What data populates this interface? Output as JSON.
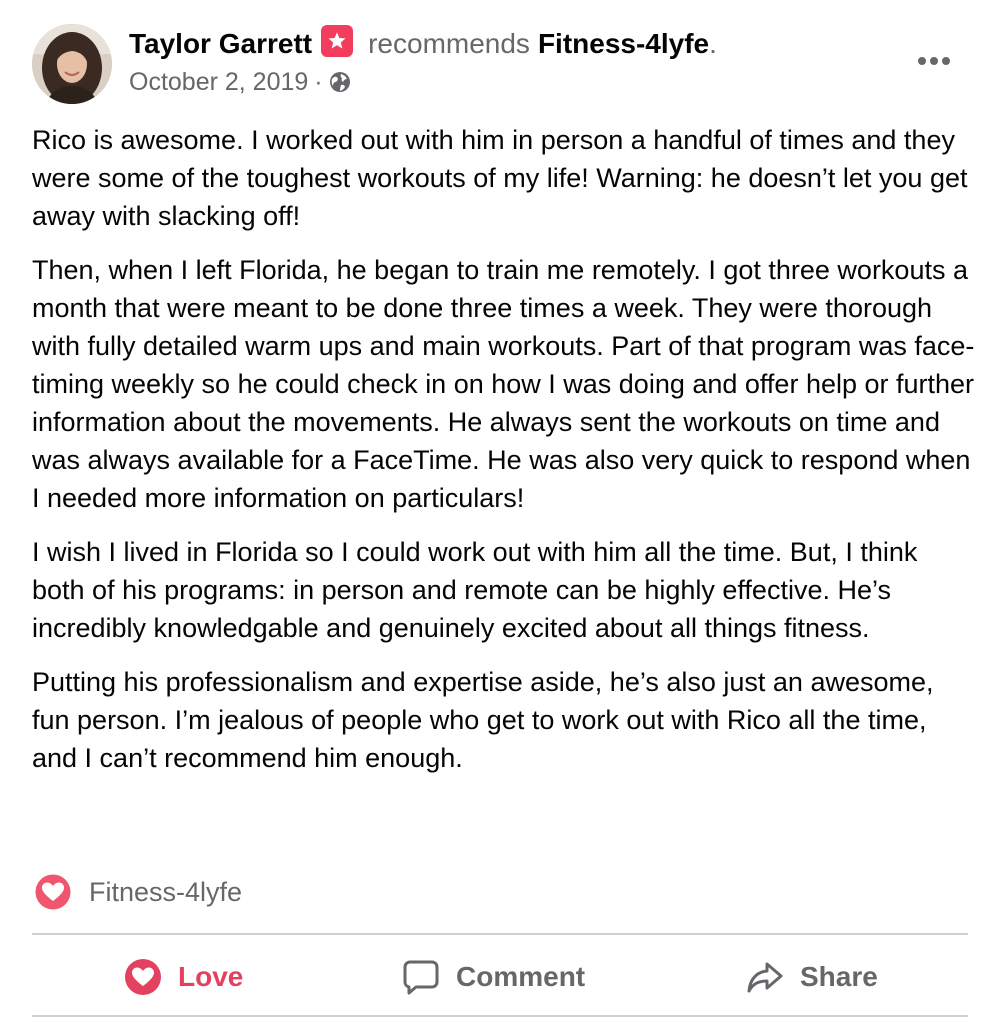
{
  "post": {
    "author": "Taylor Garrett",
    "action_text": "recommends",
    "page_name": "Fitness-4lyfe",
    "period": ".",
    "date": "October 2, 2019",
    "date_separator": "·",
    "privacy_icon": "globe-icon",
    "recommend_icon": "star-badge-icon",
    "more_icon": "more-horizontal-icon",
    "paragraphs": [
      "Rico is awesome. I worked out with him in person a handful of times and they were some of the toughest workouts of my life! Warning: he doesn’t let you get away with slacking off!",
      "Then, when I left Florida, he began to train me remotely. I got three workouts a month that were meant to be done three times a week. They were thorough with fully detailed warm ups and main workouts. Part of that program was face-timing weekly so he could check in on how I was doing and offer help or further information about the movements. He always sent the workouts on time and was always available for a FaceTime. He was also very quick to respond when I needed more information on particulars!",
      "I wish I lived in Florida so I could work out with him all the time. But, I think both of his programs: in person and remote can be highly effective. He’s incredibly knowledgable and genuinely excited about all things fitness.",
      "Putting his professionalism and expertise aside, he’s also just an awesome, fun person. I’m jealous of people who get to work out with Rico all the time, and I can’t recommend him enough."
    ]
  },
  "reactions": {
    "icon": "love-reaction-icon",
    "text": "Fitness-4lyfe"
  },
  "actions": {
    "love_label": "Love",
    "comment_label": "Comment",
    "share_label": "Share"
  },
  "colors": {
    "love": "#e4405f",
    "secondary_text": "#65676b",
    "recommend_badge": "#f23d5e",
    "divider": "#ced0d4"
  }
}
